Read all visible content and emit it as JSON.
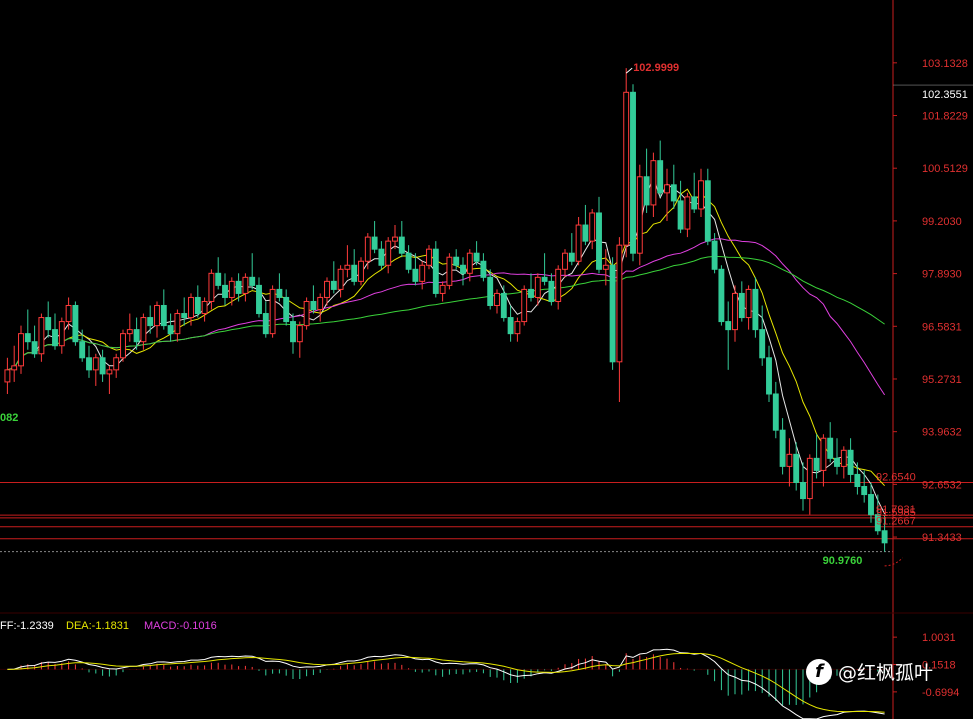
{
  "chart_data": {
    "type": "candlestick",
    "price_ylim": [
      90.4,
      103.75
    ],
    "y_ticks": [
      "103.1328",
      "101.8229",
      "100.5129",
      "99.2030",
      "97.8930",
      "96.5831",
      "95.2731",
      "93.9632",
      "92.6532",
      "91.3433"
    ],
    "y_tick_values": [
      103.1328,
      101.8229,
      100.5129,
      99.203,
      97.893,
      96.5831,
      95.2731,
      93.9632,
      92.6532,
      91.3433
    ],
    "current_price_label": "102.3551",
    "current_price_value": 102.3551,
    "high_label": "102.9999",
    "high_value": 102.9999,
    "low_label": "90.9760",
    "low_value": 90.976,
    "left_edge_label": "082",
    "left_edge_value": 94.33,
    "horizontal_lines": [
      {
        "value": 92.7,
        "label": "92.6540"
      },
      {
        "value": 91.89,
        "label": "91.7931"
      },
      {
        "value": 91.82,
        "label": "91.5985"
      },
      {
        "value": 91.6,
        "label": "91.2667"
      },
      {
        "value": 91.3,
        "label": ""
      }
    ],
    "dashed_line_value": 90.98,
    "candles": [
      [
        95.2,
        95.8,
        94.9,
        95.5
      ],
      [
        95.5,
        96.1,
        95.2,
        95.6
      ],
      [
        95.6,
        96.6,
        95.4,
        96.4
      ],
      [
        96.4,
        97.0,
        96.0,
        96.2
      ],
      [
        96.2,
        96.6,
        95.8,
        95.9
      ],
      [
        95.9,
        96.9,
        95.7,
        96.8
      ],
      [
        96.8,
        97.2,
        96.3,
        96.5
      ],
      [
        96.5,
        96.9,
        96.0,
        96.1
      ],
      [
        96.1,
        96.8,
        95.9,
        96.7
      ],
      [
        96.7,
        97.3,
        96.5,
        97.1
      ],
      [
        97.1,
        97.2,
        96.1,
        96.2
      ],
      [
        96.2,
        96.5,
        95.7,
        95.8
      ],
      [
        95.8,
        96.1,
        95.3,
        95.5
      ],
      [
        95.5,
        95.9,
        95.1,
        95.8
      ],
      [
        95.8,
        96.0,
        95.2,
        95.4
      ],
      [
        95.4,
        95.6,
        94.9,
        95.5
      ],
      [
        95.5,
        95.9,
        95.3,
        95.8
      ],
      [
        95.8,
        96.5,
        95.7,
        96.4
      ],
      [
        96.4,
        96.9,
        96.2,
        96.5
      ],
      [
        96.5,
        96.8,
        96.0,
        96.2
      ],
      [
        96.2,
        96.9,
        96.0,
        96.8
      ],
      [
        96.8,
        97.1,
        96.4,
        96.6
      ],
      [
        96.6,
        97.2,
        96.3,
        97.1
      ],
      [
        97.1,
        97.5,
        96.5,
        96.6
      ],
      [
        96.6,
        96.9,
        96.2,
        96.4
      ],
      [
        96.4,
        97.0,
        96.2,
        96.9
      ],
      [
        96.9,
        97.3,
        96.6,
        96.8
      ],
      [
        96.8,
        97.4,
        96.6,
        97.3
      ],
      [
        97.3,
        97.6,
        96.8,
        96.9
      ],
      [
        96.9,
        97.3,
        96.7,
        97.2
      ],
      [
        97.2,
        98.0,
        97.0,
        97.9
      ],
      [
        97.9,
        98.3,
        97.5,
        97.6
      ],
      [
        97.6,
        97.9,
        97.1,
        97.3
      ],
      [
        97.3,
        97.8,
        97.1,
        97.7
      ],
      [
        97.7,
        97.9,
        97.2,
        97.4
      ],
      [
        97.4,
        97.9,
        97.2,
        97.8
      ],
      [
        97.8,
        98.4,
        97.5,
        97.6
      ],
      [
        97.6,
        97.8,
        96.8,
        96.9
      ],
      [
        96.9,
        97.2,
        96.3,
        96.4
      ],
      [
        96.4,
        97.6,
        96.3,
        97.5
      ],
      [
        97.5,
        97.9,
        97.2,
        97.3
      ],
      [
        97.3,
        97.5,
        96.6,
        96.7
      ],
      [
        96.7,
        96.9,
        95.9,
        96.2
      ],
      [
        96.2,
        96.7,
        95.8,
        96.6
      ],
      [
        96.6,
        97.3,
        96.5,
        97.2
      ],
      [
        97.2,
        97.6,
        96.9,
        97.0
      ],
      [
        97.0,
        97.4,
        96.7,
        97.3
      ],
      [
        97.3,
        97.8,
        97.1,
        97.7
      ],
      [
        97.7,
        98.2,
        97.4,
        97.5
      ],
      [
        97.5,
        98.1,
        97.3,
        98.0
      ],
      [
        98.0,
        98.6,
        97.8,
        98.1
      ],
      [
        98.1,
        98.5,
        97.6,
        97.7
      ],
      [
        97.7,
        98.3,
        97.6,
        98.2
      ],
      [
        98.2,
        98.9,
        98.0,
        98.8
      ],
      [
        98.8,
        99.2,
        98.4,
        98.5
      ],
      [
        98.5,
        98.7,
        98.0,
        98.1
      ],
      [
        98.1,
        98.8,
        97.9,
        98.7
      ],
      [
        98.7,
        99.1,
        98.5,
        98.8
      ],
      [
        98.8,
        99.2,
        98.3,
        98.4
      ],
      [
        98.4,
        98.6,
        97.9,
        98.0
      ],
      [
        98.0,
        98.4,
        97.6,
        97.7
      ],
      [
        97.7,
        98.2,
        97.5,
        98.1
      ],
      [
        98.1,
        98.6,
        98.0,
        98.5
      ],
      [
        98.5,
        98.7,
        97.3,
        97.4
      ],
      [
        97.4,
        97.7,
        97.2,
        97.6
      ],
      [
        97.6,
        98.4,
        97.5,
        98.3
      ],
      [
        98.3,
        98.5,
        98.0,
        98.1
      ],
      [
        98.1,
        98.3,
        97.6,
        97.9
      ],
      [
        97.9,
        98.5,
        97.7,
        98.4
      ],
      [
        98.4,
        98.7,
        98.1,
        98.2
      ],
      [
        98.2,
        98.4,
        97.7,
        97.8
      ],
      [
        97.8,
        98.0,
        97.0,
        97.1
      ],
      [
        97.1,
        97.5,
        96.9,
        97.4
      ],
      [
        97.4,
        97.6,
        96.7,
        96.8
      ],
      [
        96.8,
        97.1,
        96.2,
        96.4
      ],
      [
        96.4,
        96.8,
        96.2,
        96.7
      ],
      [
        96.7,
        97.6,
        96.6,
        97.5
      ],
      [
        97.5,
        97.9,
        97.2,
        97.3
      ],
      [
        97.3,
        97.9,
        97.1,
        97.8
      ],
      [
        97.8,
        98.4,
        97.6,
        97.7
      ],
      [
        97.7,
        97.9,
        97.1,
        97.2
      ],
      [
        97.2,
        98.1,
        97.0,
        98.0
      ],
      [
        98.0,
        98.5,
        97.8,
        98.4
      ],
      [
        98.4,
        98.9,
        98.1,
        98.2
      ],
      [
        98.2,
        99.3,
        98.1,
        99.1
      ],
      [
        99.1,
        99.6,
        98.6,
        98.7
      ],
      [
        98.7,
        99.5,
        98.5,
        99.4
      ],
      [
        99.4,
        99.8,
        97.9,
        98.0
      ],
      [
        98.0,
        98.5,
        97.6,
        98.1
      ],
      [
        98.1,
        98.3,
        95.5,
        95.7
      ],
      [
        95.7,
        98.8,
        94.7,
        98.6
      ],
      [
        98.6,
        103.0,
        98.3,
        102.4
      ],
      [
        102.4,
        102.6,
        98.2,
        98.4
      ],
      [
        98.4,
        100.6,
        98.1,
        100.3
      ],
      [
        100.3,
        101.0,
        99.4,
        99.6
      ],
      [
        99.6,
        100.9,
        99.3,
        100.7
      ],
      [
        100.7,
        101.2,
        99.8,
        99.9
      ],
      [
        99.9,
        100.5,
        99.2,
        100.1
      ],
      [
        100.1,
        100.6,
        99.5,
        99.7
      ],
      [
        99.7,
        100.2,
        98.9,
        99.0
      ],
      [
        99.0,
        99.9,
        98.8,
        99.8
      ],
      [
        99.8,
        100.4,
        99.4,
        99.5
      ],
      [
        99.5,
        100.5,
        99.3,
        100.2
      ],
      [
        100.2,
        100.5,
        98.6,
        98.7
      ],
      [
        98.7,
        98.9,
        97.9,
        98.0
      ],
      [
        98.0,
        98.1,
        96.6,
        96.7
      ],
      [
        96.7,
        97.2,
        95.5,
        96.5
      ],
      [
        96.5,
        97.6,
        96.2,
        97.4
      ],
      [
        97.4,
        97.7,
        96.7,
        96.8
      ],
      [
        96.8,
        97.6,
        96.5,
        97.5
      ],
      [
        97.5,
        97.8,
        96.3,
        96.5
      ],
      [
        96.5,
        97.1,
        95.6,
        95.8
      ],
      [
        95.8,
        96.1,
        94.7,
        94.9
      ],
      [
        94.9,
        95.2,
        93.8,
        94.0
      ],
      [
        94.0,
        94.3,
        92.9,
        93.1
      ],
      [
        93.1,
        93.8,
        92.6,
        93.4
      ],
      [
        93.4,
        93.7,
        92.5,
        92.7
      ],
      [
        92.7,
        93.2,
        92.0,
        92.3
      ],
      [
        92.3,
        93.4,
        91.9,
        93.3
      ],
      [
        93.3,
        93.9,
        92.8,
        93.0
      ],
      [
        93.0,
        93.9,
        92.6,
        93.8
      ],
      [
        93.8,
        94.2,
        93.2,
        93.3
      ],
      [
        93.3,
        93.8,
        92.9,
        93.1
      ],
      [
        93.1,
        93.6,
        92.8,
        93.5
      ],
      [
        93.5,
        93.8,
        92.7,
        92.9
      ],
      [
        92.9,
        93.2,
        92.4,
        92.6
      ],
      [
        92.6,
        93.0,
        92.2,
        92.4
      ],
      [
        92.4,
        92.7,
        91.7,
        91.9
      ],
      [
        91.9,
        92.4,
        91.4,
        91.5
      ],
      [
        91.5,
        91.9,
        90.98,
        91.2
      ]
    ],
    "ma_series": [
      {
        "color": "#e6e6e6",
        "period": 5
      },
      {
        "color": "#e6e600",
        "period": 10
      },
      {
        "color": "#e040e0",
        "period": 30
      },
      {
        "color": "#3ad23a",
        "period": 60
      }
    ],
    "macd": {
      "labels": {
        "diff": "FF:-1.2339",
        "dea": "DEA:-1.1831",
        "macd": "MACD:-0.1016"
      },
      "y_ticks": [
        "1.0031",
        "0.1518",
        "-0.6994"
      ],
      "y_tick_values": [
        1.0031,
        0.1518,
        -0.6994
      ],
      "ylim": [
        -1.45,
        1.35
      ]
    },
    "colors": {
      "up": "#ff3b3b",
      "down": "#33cc99",
      "axis": "#c81e1e",
      "label": "#e03030",
      "green_label": "#3ad23a"
    }
  },
  "watermark": {
    "logo": "f",
    "text": "@红枫孤叶"
  }
}
